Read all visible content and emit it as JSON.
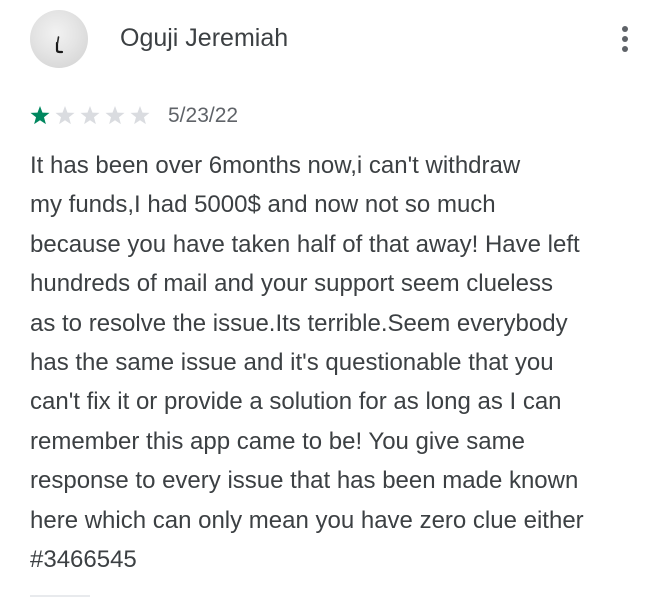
{
  "review": {
    "reviewer_name": "Oguji Jeremiah",
    "avatar_icon": "user-avatar-photo",
    "more_icon": "more-vert-icon",
    "rating": 1,
    "rating_max": 5,
    "star_filled_color": "#01875f",
    "star_empty_color": "#dadce0",
    "date": "5/23/22",
    "text_lines": [
      "It has been over 6months now,i can't withdraw",
      "my funds,I had 5000$ and now not so much",
      "because you have taken half of that away! Have left",
      "hundreds of mail and your support seem clueless",
      "as to resolve the issue.Its terrible.Seem everybody",
      "has the same issue and it's questionable that you",
      "can't fix it or provide a solution for as long as I can",
      "remember this app came to be! You give same",
      "response to every issue that has been made known",
      "here which can only mean you have zero clue either",
      "#3466545"
    ]
  }
}
